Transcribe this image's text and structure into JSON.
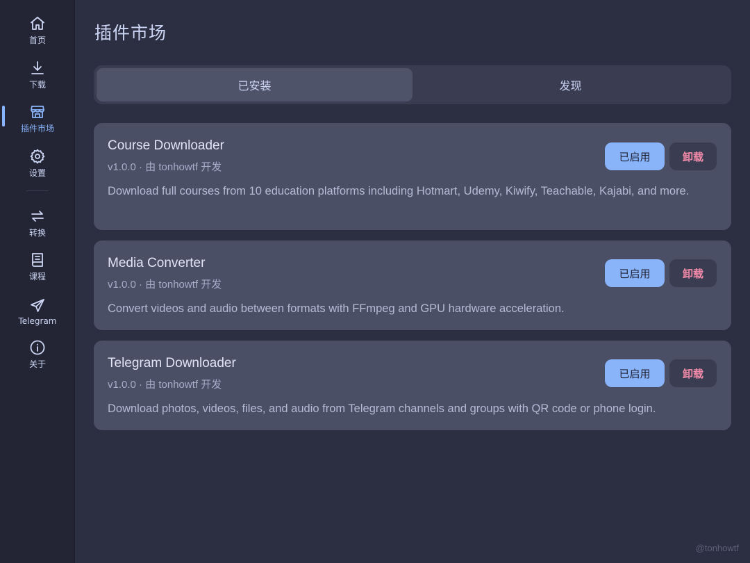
{
  "sidebar": {
    "items": [
      {
        "label": "首页",
        "icon": "home-icon"
      },
      {
        "label": "下载",
        "icon": "download-icon"
      },
      {
        "label": "插件市场",
        "icon": "store-icon"
      },
      {
        "label": "设置",
        "icon": "gear-icon"
      },
      {
        "label": "转换",
        "icon": "swap-icon"
      },
      {
        "label": "课程",
        "icon": "book-icon"
      },
      {
        "label": "Telegram",
        "icon": "send-icon"
      },
      {
        "label": "关于",
        "icon": "info-icon"
      }
    ],
    "active_index": 2
  },
  "page": {
    "title": "插件市场"
  },
  "tabs": [
    {
      "label": "已安装",
      "active": true
    },
    {
      "label": "发现",
      "active": false
    }
  ],
  "plugins": [
    {
      "name": "Course Downloader",
      "meta": "v1.0.0 · 由 tonhowtf 开发",
      "description": "Download full courses from 10 education platforms including Hotmart, Udemy, Kiwify, Teachable, Kajabi, and more.",
      "enabled_label": "已启用",
      "uninstall_label": "卸载"
    },
    {
      "name": "Media Converter",
      "meta": "v1.0.0 · 由 tonhowtf 开发",
      "description": "Convert videos and audio between formats with FFmpeg and GPU hardware acceleration.",
      "enabled_label": "已启用",
      "uninstall_label": "卸载"
    },
    {
      "name": "Telegram Downloader",
      "meta": "v1.0.0 · 由 tonhowtf 开发",
      "description": "Download photos, videos, files, and audio from Telegram channels and groups with QR code or phone login.",
      "enabled_label": "已启用",
      "uninstall_label": "卸载"
    }
  ],
  "watermark": "@tonhowtf",
  "colors": {
    "accent": "#89b4fa",
    "danger": "#f38ba8",
    "background": "#2c2f42",
    "sidebar": "#232535",
    "card": "#4b4f66"
  }
}
